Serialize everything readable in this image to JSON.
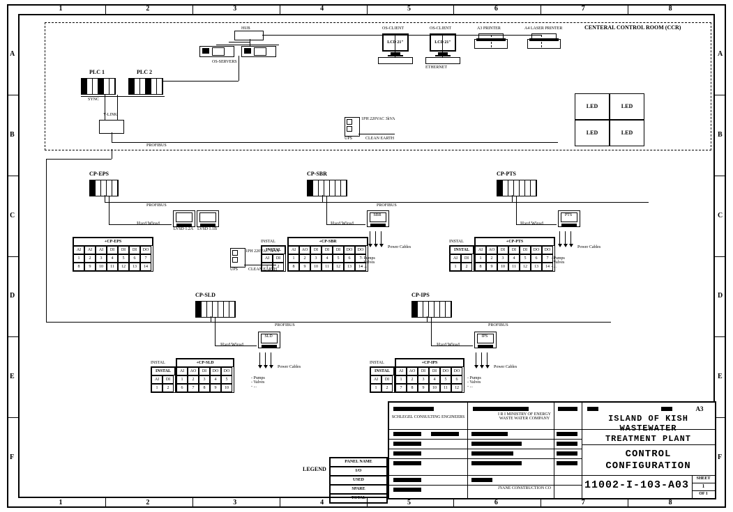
{
  "grid": {
    "cols": [
      "1",
      "2",
      "3",
      "4",
      "5",
      "6",
      "7",
      "8"
    ],
    "rows": [
      "A",
      "B",
      "C",
      "D",
      "E",
      "F"
    ]
  },
  "ccr": {
    "title": "CENTERAL CONTROL ROOM (CCR)"
  },
  "top": {
    "hub": "HUB",
    "os_servers": "OS-SERVERS",
    "os_client": "OS-CLIENT",
    "lcd": "LCD 21\"",
    "a3": "A3  PRINTER",
    "a4": "A4 LASER PRINTER",
    "plc1": "PLC 1",
    "plc2": "PLC 2",
    "ylink": "Y-LINK",
    "profibus": "PROFIBUS",
    "ups": "UPS",
    "ups_spec": "1PH 220VAC 3kVA",
    "clean": "CLEAN EARTH",
    "led": "LED",
    "ethernet": "ETHERNET"
  },
  "panels": {
    "eps": {
      "name": "CP-EPS",
      "hw": "Hard Wired",
      "bus": "PROFIBUS",
      "tbl_hd": "+CP-EPS",
      "lvs1": "LVSD 1.2A",
      "lvs2": "LVSD 1.1B"
    },
    "sbr": {
      "name": "CP-SBR",
      "hw": "Hard Wired",
      "bus": "PROFIBUS",
      "tbl_hd": "+CP-SBR",
      "hmi": "SBR",
      "pc": "Power Cables",
      "pv": "- Pumps\n- Valves\n- ..."
    },
    "pts": {
      "name": "CP-PTS",
      "hw": "Hard Wired",
      "bus": "PROFIBUS",
      "tbl_hd": "+CP-PTS",
      "hmi": "PTS",
      "pc": "Power Cables",
      "pv": "- Pumps\n- Valves\n- ..."
    },
    "sld": {
      "name": "CP-SLD",
      "hw": "Hard Wired",
      "bus": "PROFIBUS",
      "tbl_hd": "+CP-SLD",
      "hmi": "SLD",
      "pc": "Power Cables",
      "pv": "- Pumps\n- Valves\n- ..."
    },
    "ips": {
      "name": "CP-IPS",
      "hw": "Hard Wired",
      "bus": "PROFIBUS",
      "tbl_hd": "+CP-IPS",
      "hmi": "IPS",
      "pc": "Power Cables",
      "pv": "- Pumps\n- Valves\n- ..."
    },
    "instal": "INSTAL"
  },
  "slots": {
    "eps": [
      [
        "AI",
        "AI",
        "AI",
        "DI",
        "DI",
        "DI",
        "DO"
      ],
      [
        "1",
        "2",
        "3",
        "4",
        "5",
        "6",
        "7"
      ],
      [
        "8",
        "9",
        "10",
        "11",
        "12",
        "13",
        "14"
      ]
    ],
    "sbr": [
      [
        "AI",
        "AO",
        "DI",
        "DI",
        "DI",
        "DO",
        "DO"
      ],
      [
        "1",
        "2",
        "3",
        "4",
        "5",
        "6",
        "7"
      ],
      [
        "8",
        "9",
        "10",
        "11",
        "12",
        "13",
        "14"
      ]
    ],
    "pts": [
      [
        "AI",
        "AO",
        "DI",
        "DI",
        "DI",
        "DO",
        "DO"
      ],
      [
        "1",
        "2",
        "3",
        "4",
        "5",
        "6",
        "7"
      ],
      [
        "8",
        "9",
        "10",
        "11",
        "12",
        "13",
        "14"
      ]
    ],
    "sld": [
      [
        "AI",
        "AO",
        "DI",
        "DO",
        "DO"
      ],
      [
        "1",
        "2",
        "3",
        "4",
        "5"
      ],
      [
        "6",
        "7",
        "8",
        "9",
        "10"
      ]
    ],
    "ips": [
      [
        "AI",
        "AO",
        "DI",
        "DI",
        "DO",
        "DO"
      ],
      [
        "1",
        "2",
        "3",
        "4",
        "5",
        "6"
      ],
      [
        "7",
        "8",
        "9",
        "10",
        "11",
        "12"
      ]
    ],
    "inst": [
      [
        "AI",
        "DI"
      ],
      [
        "1",
        "2"
      ]
    ]
  },
  "legend": {
    "title": "LEGEND",
    "rows": [
      "PANEL NAME",
      "I/O",
      "USED",
      "SPARE",
      "TOTAL"
    ]
  },
  "tb": {
    "cons": "SCHLEGEL CONSULTING ENGINEERS",
    "owner1": "I R I  MINISTRY OF ENERGY",
    "owner2": "WASTE WATER COMPANY",
    "contr": "JYANE CONSTRUCTION CO",
    "proj1": "ISLAND OF KISH WASTEWATER",
    "proj2": "TREATMENT PLANT",
    "title1": "CONTROL",
    "title2": "CONFIGURATION",
    "dwg": "11002-I-103-A03",
    "size": "A3",
    "sheet": "SHEET",
    "sh_no": "1",
    "of": "OF 1"
  }
}
